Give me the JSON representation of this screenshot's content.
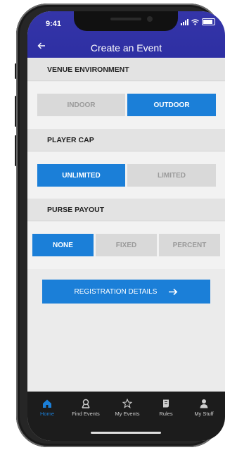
{
  "status_bar": {
    "time": "9:41"
  },
  "header": {
    "title": "Create an Event",
    "back_icon": "arrow-left-icon"
  },
  "sections": {
    "venue": {
      "title": "VENUE ENVIRONMENT",
      "options": [
        "INDOOR",
        "OUTDOOR"
      ],
      "selected": "OUTDOOR"
    },
    "player_cap": {
      "title": "PLAYER CAP",
      "options": [
        "UNLIMITED",
        "LIMITED"
      ],
      "selected": "UNLIMITED"
    },
    "purse": {
      "title": "PURSE PAYOUT",
      "options": [
        "NONE",
        "FIXED",
        "PERCENT"
      ],
      "selected": "NONE"
    }
  },
  "registration_button": {
    "label": "REGISTRATION DETAILS",
    "icon": "arrow-right-icon"
  },
  "tabs": [
    {
      "label": "Home",
      "icon": "home-icon",
      "active": true
    },
    {
      "label": "Find Events",
      "icon": "find-events-icon",
      "active": false
    },
    {
      "label": "My Events",
      "icon": "star-icon",
      "active": false
    },
    {
      "label": "Rules",
      "icon": "rules-icon",
      "active": false
    },
    {
      "label": "My Stuff",
      "icon": "person-icon",
      "active": false
    }
  ],
  "colors": {
    "header": "#2e2fa3",
    "accent": "#1b7fd8",
    "tabbar": "#1c1c1c"
  }
}
